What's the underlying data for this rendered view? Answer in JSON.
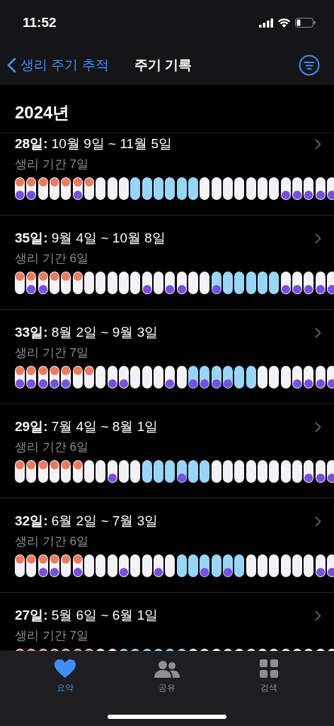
{
  "status_bar": {
    "time": "11:52"
  },
  "nav": {
    "back": "생리 주기 추적",
    "title": "주기 기록"
  },
  "year": "2024년",
  "cycles": [
    {
      "title": "**28일:** 10월 9일 ~ 11월 5일",
      "subtitle": "생리 기간 7일",
      "days": [
        {
          "period": true,
          "fertile": false,
          "symptom": true
        },
        {
          "period": true,
          "fertile": false,
          "symptom": true
        },
        {
          "period": true,
          "fertile": false,
          "symptom": false
        },
        {
          "period": true,
          "fertile": false,
          "symptom": false
        },
        {
          "period": true,
          "fertile": false,
          "symptom": false
        },
        {
          "period": true,
          "fertile": false,
          "symptom": true
        },
        {
          "period": true,
          "fertile": false,
          "symptom": false
        },
        {
          "period": false,
          "fertile": false,
          "symptom": false
        },
        {
          "period": false,
          "fertile": false,
          "symptom": false
        },
        {
          "period": false,
          "fertile": false,
          "symptom": false
        },
        {
          "period": false,
          "fertile": true,
          "symptom": false
        },
        {
          "period": false,
          "fertile": true,
          "symptom": false
        },
        {
          "period": false,
          "fertile": true,
          "symptom": false
        },
        {
          "period": false,
          "fertile": true,
          "symptom": false
        },
        {
          "period": false,
          "fertile": true,
          "symptom": false
        },
        {
          "period": false,
          "fertile": true,
          "symptom": false
        },
        {
          "period": false,
          "fertile": false,
          "symptom": false
        },
        {
          "period": false,
          "fertile": false,
          "symptom": false
        },
        {
          "period": false,
          "fertile": false,
          "symptom": false
        },
        {
          "period": false,
          "fertile": false,
          "symptom": false
        },
        {
          "period": false,
          "fertile": false,
          "symptom": false
        },
        {
          "period": false,
          "fertile": false,
          "symptom": false
        },
        {
          "period": false,
          "fertile": false,
          "symptom": false
        },
        {
          "period": false,
          "fertile": false,
          "symptom": true
        },
        {
          "period": false,
          "fertile": false,
          "symptom": true
        },
        {
          "period": false,
          "fertile": false,
          "symptom": true
        },
        {
          "period": false,
          "fertile": false,
          "symptom": true
        },
        {
          "period": false,
          "fertile": false,
          "symptom": true
        }
      ]
    },
    {
      "title": "**35일:** 9월 4일 ~ 10월 8일",
      "subtitle": "생리 기간 6일",
      "days": [
        {
          "period": true,
          "fertile": false,
          "symptom": false
        },
        {
          "period": true,
          "fertile": false,
          "symptom": true
        },
        {
          "period": true,
          "fertile": false,
          "symptom": true
        },
        {
          "period": true,
          "fertile": false,
          "symptom": false
        },
        {
          "period": true,
          "fertile": false,
          "symptom": false
        },
        {
          "period": true,
          "fertile": false,
          "symptom": false
        },
        {
          "period": false,
          "fertile": false,
          "symptom": false
        },
        {
          "period": false,
          "fertile": false,
          "symptom": false
        },
        {
          "period": false,
          "fertile": false,
          "symptom": false
        },
        {
          "period": false,
          "fertile": false,
          "symptom": false
        },
        {
          "period": false,
          "fertile": false,
          "symptom": false
        },
        {
          "period": false,
          "fertile": false,
          "symptom": true
        },
        {
          "period": false,
          "fertile": false,
          "symptom": false
        },
        {
          "period": false,
          "fertile": false,
          "symptom": true
        },
        {
          "period": false,
          "fertile": false,
          "symptom": true
        },
        {
          "period": false,
          "fertile": false,
          "symptom": false
        },
        {
          "period": false,
          "fertile": false,
          "symptom": false
        },
        {
          "period": false,
          "fertile": true,
          "symptom": true
        },
        {
          "period": false,
          "fertile": true,
          "symptom": false
        },
        {
          "period": false,
          "fertile": true,
          "symptom": false
        },
        {
          "period": false,
          "fertile": true,
          "symptom": false
        },
        {
          "period": false,
          "fertile": true,
          "symptom": false
        },
        {
          "period": false,
          "fertile": true,
          "symptom": false
        },
        {
          "period": false,
          "fertile": false,
          "symptom": true
        },
        {
          "period": false,
          "fertile": false,
          "symptom": true
        },
        {
          "period": false,
          "fertile": false,
          "symptom": true
        },
        {
          "period": false,
          "fertile": false,
          "symptom": true
        },
        {
          "period": false,
          "fertile": false,
          "symptom": true
        }
      ]
    },
    {
      "title": "**33일:** 8월 2일 ~ 9월 3일",
      "subtitle": "생리 기간 7일",
      "days": [
        {
          "period": true,
          "fertile": false,
          "symptom": true
        },
        {
          "period": true,
          "fertile": false,
          "symptom": true
        },
        {
          "period": true,
          "fertile": false,
          "symptom": true
        },
        {
          "period": true,
          "fertile": false,
          "symptom": true
        },
        {
          "period": true,
          "fertile": false,
          "symptom": true
        },
        {
          "period": true,
          "fertile": false,
          "symptom": false
        },
        {
          "period": true,
          "fertile": false,
          "symptom": false
        },
        {
          "period": false,
          "fertile": false,
          "symptom": false
        },
        {
          "period": false,
          "fertile": false,
          "symptom": true
        },
        {
          "period": false,
          "fertile": false,
          "symptom": true
        },
        {
          "period": false,
          "fertile": false,
          "symptom": false
        },
        {
          "period": false,
          "fertile": false,
          "symptom": false
        },
        {
          "period": false,
          "fertile": false,
          "symptom": false
        },
        {
          "period": false,
          "fertile": false,
          "symptom": true
        },
        {
          "period": false,
          "fertile": false,
          "symptom": false
        },
        {
          "period": false,
          "fertile": true,
          "symptom": true
        },
        {
          "period": false,
          "fertile": true,
          "symptom": true
        },
        {
          "period": false,
          "fertile": true,
          "symptom": true
        },
        {
          "period": false,
          "fertile": true,
          "symptom": true
        },
        {
          "period": false,
          "fertile": true,
          "symptom": false
        },
        {
          "period": false,
          "fertile": true,
          "symptom": false
        },
        {
          "period": false,
          "fertile": false,
          "symptom": false
        },
        {
          "period": false,
          "fertile": false,
          "symptom": false
        },
        {
          "period": false,
          "fertile": false,
          "symptom": false
        },
        {
          "period": false,
          "fertile": false,
          "symptom": true
        },
        {
          "period": false,
          "fertile": false,
          "symptom": true
        },
        {
          "period": false,
          "fertile": false,
          "symptom": true
        },
        {
          "period": false,
          "fertile": false,
          "symptom": true
        }
      ]
    },
    {
      "title": "**29일:** 7월 4일 ~ 8월 1일",
      "subtitle": "생리 기간 6일",
      "days": [
        {
          "period": true,
          "fertile": false,
          "symptom": false
        },
        {
          "period": true,
          "fertile": false,
          "symptom": false
        },
        {
          "period": true,
          "fertile": false,
          "symptom": false
        },
        {
          "period": true,
          "fertile": false,
          "symptom": false
        },
        {
          "period": true,
          "fertile": false,
          "symptom": false
        },
        {
          "period": true,
          "fertile": false,
          "symptom": false
        },
        {
          "period": false,
          "fertile": false,
          "symptom": false
        },
        {
          "period": false,
          "fertile": false,
          "symptom": false
        },
        {
          "period": false,
          "fertile": false,
          "symptom": true
        },
        {
          "period": false,
          "fertile": false,
          "symptom": false
        },
        {
          "period": false,
          "fertile": false,
          "symptom": false
        },
        {
          "period": false,
          "fertile": true,
          "symptom": false
        },
        {
          "period": false,
          "fertile": true,
          "symptom": false
        },
        {
          "period": false,
          "fertile": true,
          "symptom": false
        },
        {
          "period": false,
          "fertile": true,
          "symptom": true
        },
        {
          "period": false,
          "fertile": true,
          "symptom": false
        },
        {
          "period": false,
          "fertile": true,
          "symptom": false
        },
        {
          "period": false,
          "fertile": false,
          "symptom": false
        },
        {
          "period": false,
          "fertile": false,
          "symptom": false
        },
        {
          "period": false,
          "fertile": false,
          "symptom": false
        },
        {
          "period": false,
          "fertile": false,
          "symptom": false
        },
        {
          "period": false,
          "fertile": false,
          "symptom": false
        },
        {
          "period": false,
          "fertile": false,
          "symptom": false
        },
        {
          "period": false,
          "fertile": false,
          "symptom": false
        },
        {
          "period": false,
          "fertile": false,
          "symptom": false
        },
        {
          "period": false,
          "fertile": false,
          "symptom": true
        },
        {
          "period": false,
          "fertile": false,
          "symptom": true
        },
        {
          "period": false,
          "fertile": false,
          "symptom": true
        }
      ]
    },
    {
      "title": "**32일:** 6월 2일 ~ 7월 3일",
      "subtitle": "생리 기간 6일",
      "days": [
        {
          "period": true,
          "fertile": false,
          "symptom": false
        },
        {
          "period": true,
          "fertile": false,
          "symptom": false
        },
        {
          "period": true,
          "fertile": false,
          "symptom": true
        },
        {
          "period": true,
          "fertile": false,
          "symptom": true
        },
        {
          "period": true,
          "fertile": false,
          "symptom": false
        },
        {
          "period": true,
          "fertile": false,
          "symptom": true
        },
        {
          "period": false,
          "fertile": false,
          "symptom": false
        },
        {
          "period": false,
          "fertile": false,
          "symptom": false
        },
        {
          "period": false,
          "fertile": false,
          "symptom": false
        },
        {
          "period": false,
          "fertile": false,
          "symptom": true
        },
        {
          "period": false,
          "fertile": false,
          "symptom": false
        },
        {
          "period": false,
          "fertile": false,
          "symptom": false
        },
        {
          "period": false,
          "fertile": false,
          "symptom": true
        },
        {
          "period": false,
          "fertile": false,
          "symptom": false
        },
        {
          "period": false,
          "fertile": true,
          "symptom": false
        },
        {
          "period": false,
          "fertile": true,
          "symptom": false
        },
        {
          "period": false,
          "fertile": true,
          "symptom": true
        },
        {
          "period": false,
          "fertile": true,
          "symptom": false
        },
        {
          "period": false,
          "fertile": true,
          "symptom": true
        },
        {
          "period": false,
          "fertile": true,
          "symptom": false
        },
        {
          "period": false,
          "fertile": false,
          "symptom": false
        },
        {
          "period": false,
          "fertile": false,
          "symptom": false
        },
        {
          "period": false,
          "fertile": false,
          "symptom": false
        },
        {
          "period": false,
          "fertile": false,
          "symptom": false
        },
        {
          "period": false,
          "fertile": false,
          "symptom": false
        },
        {
          "period": false,
          "fertile": false,
          "symptom": false
        },
        {
          "period": false,
          "fertile": false,
          "symptom": true
        },
        {
          "period": false,
          "fertile": false,
          "symptom": true
        }
      ]
    },
    {
      "title": "**27일:** 5월 6일 ~ 6월 1일",
      "subtitle": "생리 기간 7일",
      "days": [
        {
          "period": true,
          "fertile": false
        },
        {
          "period": true,
          "fertile": false
        },
        {
          "period": true,
          "fertile": false
        },
        {
          "period": true,
          "fertile": false
        },
        {
          "period": true,
          "fertile": false
        },
        {
          "period": true,
          "fertile": false
        },
        {
          "period": true,
          "fertile": false
        },
        {
          "period": false,
          "fertile": false
        },
        {
          "period": false,
          "fertile": false
        },
        {
          "period": false,
          "fertile": true
        },
        {
          "period": false,
          "fertile": true
        },
        {
          "period": false,
          "fertile": true
        },
        {
          "period": false,
          "fertile": true
        },
        {
          "period": false,
          "fertile": true
        },
        {
          "period": false,
          "fertile": true
        },
        {
          "period": false,
          "fertile": false
        },
        {
          "period": false,
          "fertile": false
        },
        {
          "period": false,
          "fertile": false
        },
        {
          "period": false,
          "fertile": false
        },
        {
          "period": false,
          "fertile": false
        },
        {
          "period": false,
          "fertile": false
        },
        {
          "period": false,
          "fertile": false
        },
        {
          "period": false,
          "fertile": false
        },
        {
          "period": false,
          "fertile": false
        },
        {
          "period": false,
          "fertile": false
        },
        {
          "period": false,
          "fertile": false
        },
        {
          "period": false,
          "fertile": false
        },
        {
          "period": false,
          "fertile": false
        }
      ]
    }
  ],
  "tabs": [
    {
      "label": "요약",
      "kind": "heart",
      "selected": true
    },
    {
      "label": "공유",
      "kind": "people",
      "selected": false
    },
    {
      "label": "검색",
      "kind": "grid",
      "selected": false
    }
  ]
}
